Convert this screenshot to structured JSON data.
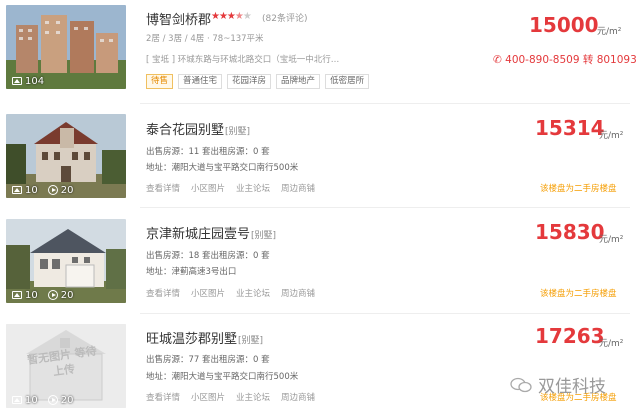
{
  "listings": [
    {
      "title": "博智剑桥郡",
      "tag": "",
      "rating": 3.5,
      "reviews": "(82条评论)",
      "layout": "2居 / 3居 / 4居",
      "area": "78~137平米",
      "address": "[ 宝坻 ] 环城东路与环城北路交口（宝坻一中北行…",
      "chips": [
        "待售",
        "普通住宅",
        "花园洋房",
        "品牌地产",
        "低密居所"
      ],
      "price": "15000",
      "unit": "元/m²",
      "phone": "400-890-8509 转 801093",
      "photos": "104",
      "videos": ""
    },
    {
      "title": "泰合花园别墅",
      "tag": "[别墅]",
      "line1": "出售房源：11 套出租房源：0 套",
      "line2": "地址：潮阳大道与宝平路交口南行500米",
      "links": [
        "查看详情",
        "小区图片",
        "业主论坛",
        "周边商铺"
      ],
      "resale": "该楼盘为二手房楼盘",
      "price": "15314",
      "unit": "元/m²",
      "photos": "10",
      "videos": "20"
    },
    {
      "title": "京津新城庄园壹号",
      "tag": "[别墅]",
      "line1": "出售房源：18 套出租房源：0 套",
      "line2": "地址：津蓟高速3号出口",
      "links": [
        "查看详情",
        "小区图片",
        "业主论坛",
        "周边商铺"
      ],
      "resale": "该楼盘为二手房楼盘",
      "price": "15830",
      "unit": "元/m²",
      "photos": "10",
      "videos": "20"
    },
    {
      "title": "旺城温莎郡别墅",
      "tag": "[别墅]",
      "line1": "出售房源：77 套出租房源：0 套",
      "line2": "地址：潮阳大道与宝平路交口南行500米",
      "links": [
        "查看详情",
        "小区图片",
        "业主论坛",
        "周边商铺"
      ],
      "resale": "该楼盘为二手房楼盘",
      "price": "17263",
      "unit": "元/m²",
      "photos": "10",
      "videos": "20",
      "placeholder_text": "暂无图片 等待上传"
    }
  ],
  "watermark": "双佳科技",
  "colors": {
    "price": "#e4393c",
    "resale": "#f59d00",
    "chip_hot": "#e68a00"
  }
}
